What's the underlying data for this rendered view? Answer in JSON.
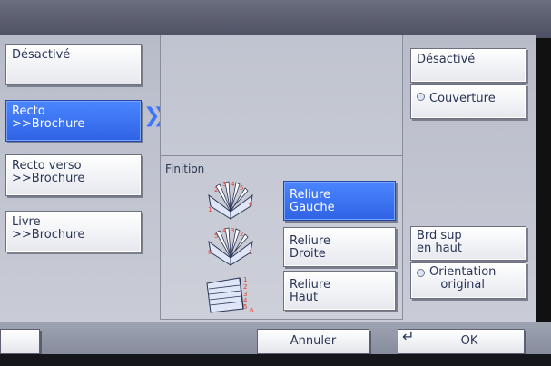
{
  "left_options": [
    {
      "label": "Désactivé"
    },
    {
      "label": "Recto\n>>Brochure"
    },
    {
      "label": "Recto verso\n>>Brochure"
    },
    {
      "label": "Livre\n>>Brochure"
    }
  ],
  "section": {
    "title": "Finition"
  },
  "binding_options": [
    {
      "label": "Reliure\nGauche"
    },
    {
      "label": "Reliure\nDroite"
    },
    {
      "label": "Reliure\nHaut"
    }
  ],
  "right": {
    "off_label": "Désactivé",
    "cover_label": "Couverture",
    "top_edge_label": "Brd sup\nen haut",
    "orientation_label": "Orientation\noriginal"
  },
  "bottom": {
    "cancel_label": "Annuler",
    "ok_label": "OK"
  },
  "colors": {
    "selected": "#3a74ff"
  }
}
